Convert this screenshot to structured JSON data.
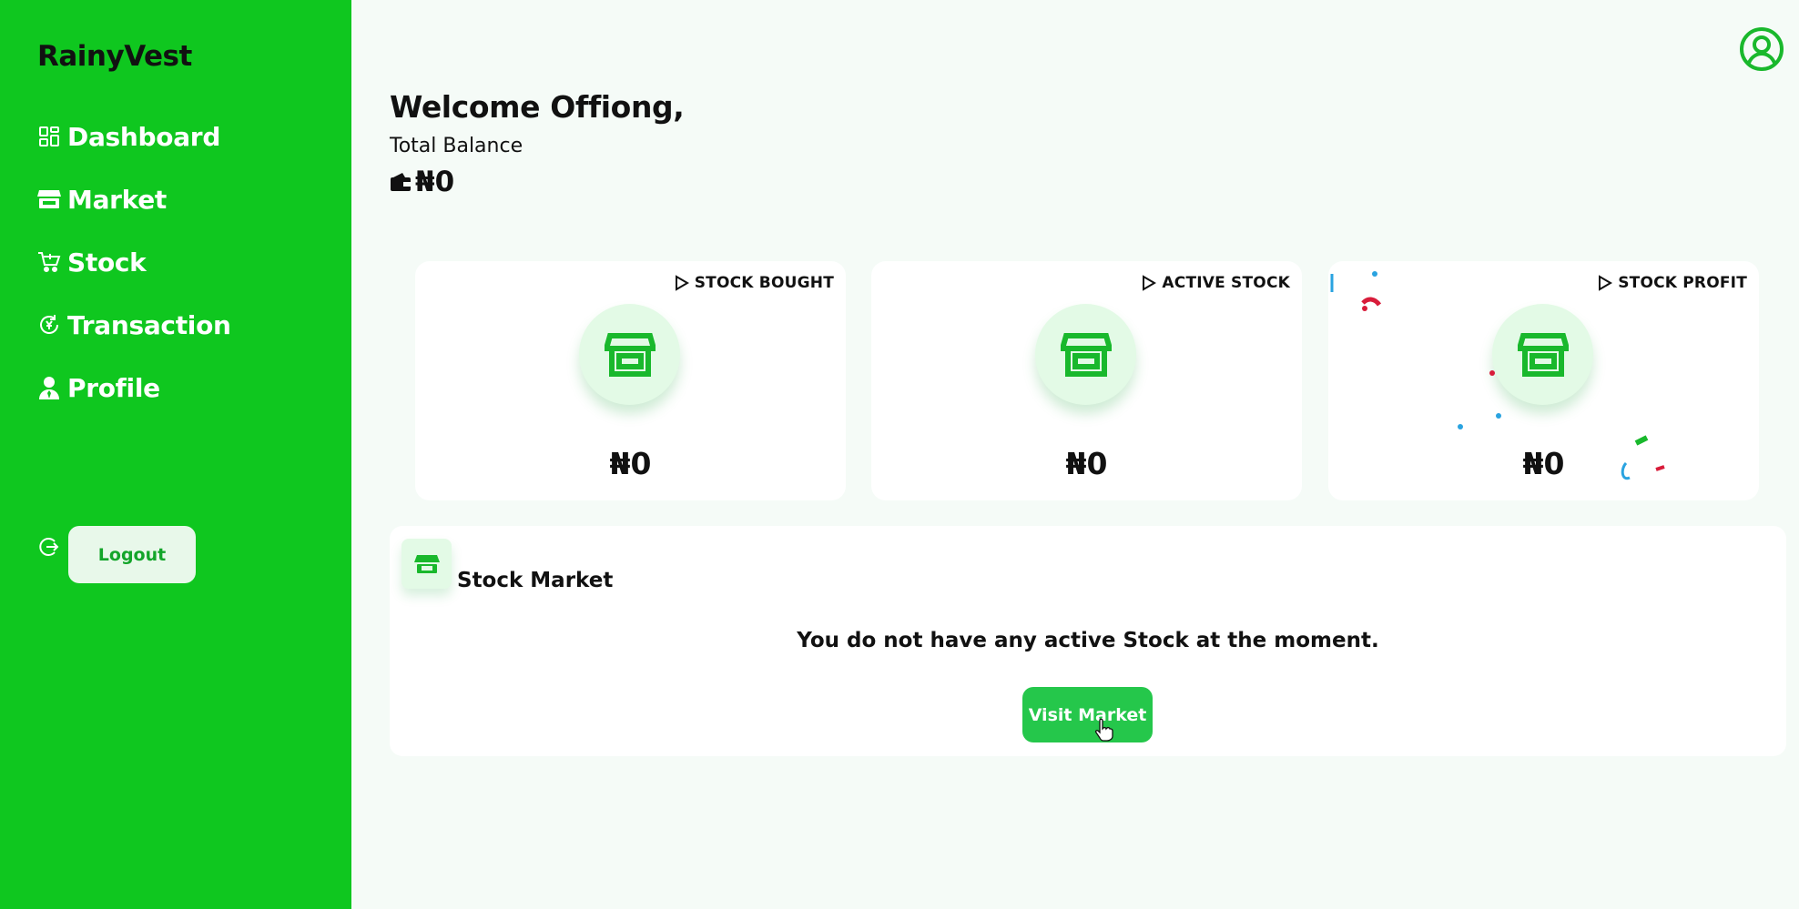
{
  "sidebar": {
    "brand": "RainyVest",
    "items": [
      {
        "label": "Dashboard",
        "icon": "dashboard-icon"
      },
      {
        "label": "Market",
        "icon": "store-icon"
      },
      {
        "label": "Stock",
        "icon": "cart-icon"
      },
      {
        "label": "Transaction",
        "icon": "transaction-icon"
      },
      {
        "label": "Profile",
        "icon": "user-icon"
      }
    ],
    "logout_label": "Logout"
  },
  "header": {
    "welcome": "Welcome Offiong,",
    "balance_label": "Total Balance",
    "balance_value": "₦0"
  },
  "stats": [
    {
      "label": "STOCK BOUGHT",
      "value": "₦0",
      "icon": "store-icon"
    },
    {
      "label": "ACTIVE STOCK",
      "value": "₦0",
      "icon": "store-icon"
    },
    {
      "label": "STOCK PROFIT",
      "value": "₦0",
      "icon": "store-icon"
    }
  ],
  "market": {
    "title": "Stock Market",
    "empty_message": "You do not have any active Stock at the moment.",
    "button_label": "Visit Market"
  },
  "colors": {
    "sidebar_bg": "#0fc71f",
    "accent": "#25c74b",
    "icon_green": "#19b82c"
  }
}
